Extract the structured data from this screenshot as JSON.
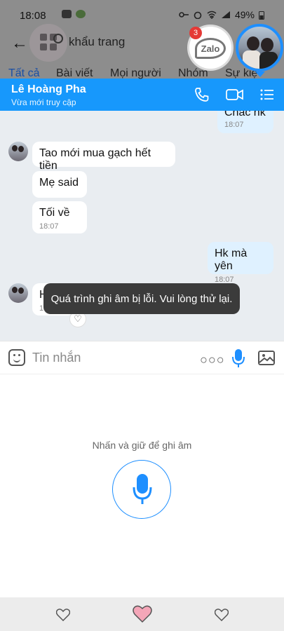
{
  "status_bar": {
    "time": "18:08",
    "battery": "49%"
  },
  "search": {
    "query": "khẩu trang",
    "tabs": [
      "Tất cả",
      "Bài viết",
      "Mọi người",
      "Nhóm",
      "Sự kiệ"
    ]
  },
  "chat_bubbles": {
    "zalo_label": "Zalo",
    "zalo_badge": "3"
  },
  "chat_header": {
    "contact_name": "Lê Hoàng Pha",
    "contact_status": "Vừa mới truy cập"
  },
  "messages": [
    {
      "side": "mine",
      "text": "Chắc hk",
      "time": "18:07"
    },
    {
      "side": "theirs",
      "text": "Tao mới mua gạch hết tiền",
      "time": ""
    },
    {
      "side": "theirs",
      "text": "Mẹ said",
      "time": ""
    },
    {
      "side": "theirs",
      "text": "Tối về",
      "time": "18:07"
    },
    {
      "side": "mine",
      "text": "Hk mà yên",
      "time": "18:07"
    },
    {
      "side": "theirs",
      "text": "H",
      "time": "18"
    }
  ],
  "toast": {
    "text": "Quá trình ghi âm bị lỗi. Vui lòng thử lại."
  },
  "input": {
    "placeholder": "Tin nhắn"
  },
  "voice": {
    "hint": "Nhấn và giữ để ghi âm"
  },
  "colors": {
    "header_blue": "#1798fc",
    "accent_blue": "#1e8fff",
    "heart_pink": "#f4a6b8"
  },
  "icons": [
    "back-arrow-icon",
    "grid-icon",
    "search-icon",
    "phone-icon",
    "video-icon",
    "menu-list-icon",
    "emoji-icon",
    "more-icon",
    "microphone-icon",
    "image-icon",
    "heart-icon"
  ]
}
